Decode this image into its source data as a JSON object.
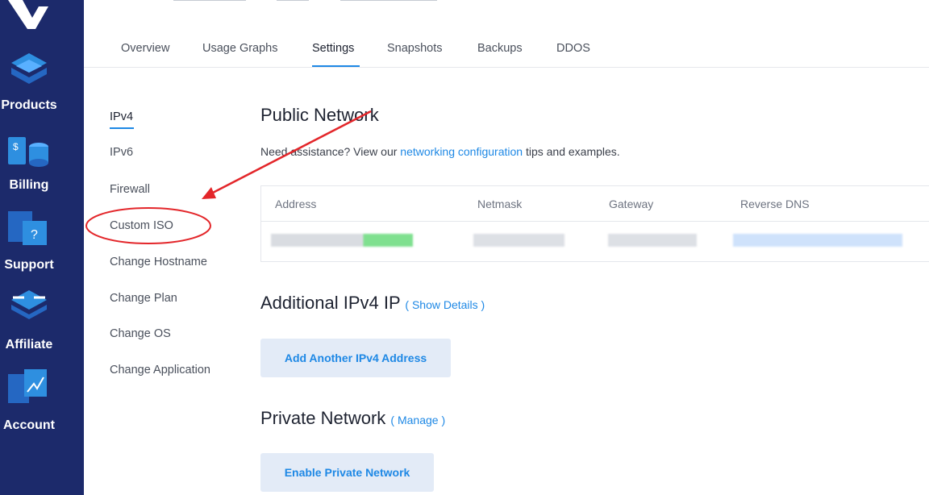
{
  "sidebar": {
    "items": [
      {
        "label": "Products",
        "icon": "products-icon"
      },
      {
        "label": "Billing",
        "icon": "billing-icon"
      },
      {
        "label": "Support",
        "icon": "support-icon"
      },
      {
        "label": "Affiliate",
        "icon": "affiliate-icon"
      },
      {
        "label": "Account",
        "icon": "account-icon"
      }
    ]
  },
  "tabs": [
    {
      "label": "Overview"
    },
    {
      "label": "Usage Graphs"
    },
    {
      "label": "Settings"
    },
    {
      "label": "Snapshots"
    },
    {
      "label": "Backups"
    },
    {
      "label": "DDOS"
    }
  ],
  "subnav": [
    {
      "label": "IPv4"
    },
    {
      "label": "IPv6"
    },
    {
      "label": "Firewall"
    },
    {
      "label": "Custom ISO"
    },
    {
      "label": "Change Hostname"
    },
    {
      "label": "Change Plan"
    },
    {
      "label": "Change OS"
    },
    {
      "label": "Change Application"
    }
  ],
  "public_network": {
    "title": "Public Network",
    "assist_prefix": "Need assistance? View our ",
    "assist_link": "networking configuration",
    "assist_suffix": " tips and examples.",
    "columns": [
      "Address",
      "Netmask",
      "Gateway",
      "Reverse DNS"
    ]
  },
  "additional_ip": {
    "title": "Additional IPv4 IP",
    "link": "( Show Details )",
    "button": "Add Another IPv4 Address"
  },
  "private_network": {
    "title": "Private Network",
    "link": "( Manage )",
    "button": "Enable Private Network"
  },
  "colors": {
    "sidebar": "#1c2a6b",
    "accent": "#1e88e5",
    "annotation": "#e3262a"
  }
}
